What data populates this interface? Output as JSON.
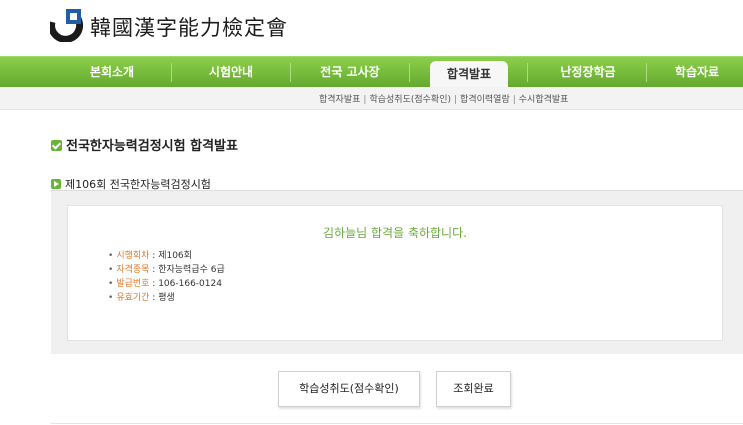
{
  "header": {
    "logo_text": "韓國漢字能力檢定會",
    "colors": {
      "brand_blue": "#1e5fa8",
      "brand_dark": "#1a1a1a",
      "nav_green": "#74bb3b",
      "accent_orange": "#e07a2c"
    }
  },
  "nav": {
    "items": [
      {
        "label": "본회소개"
      },
      {
        "label": "시험안내"
      },
      {
        "label": "전국 고사장"
      },
      {
        "label": "합격발표",
        "active": true
      },
      {
        "label": "난정장학금"
      },
      {
        "label": "학습자료"
      }
    ]
  },
  "subnav": {
    "links": [
      "합격자발표",
      "학습성취도(점수확인)",
      "합격이력열람",
      "수시합격발표"
    ],
    "separator": "|"
  },
  "main": {
    "page_title": "전국한자능력검정시험 합격발표",
    "section_title": "제106회 전국한자능력검정시험",
    "congrats": "김하늘님 합격을 축하합니다.",
    "info": [
      {
        "label": "시행회차",
        "value": "제106회"
      },
      {
        "label": "자격종목",
        "value": "한자능력급수 6급"
      },
      {
        "label": "발급번호",
        "value": "106-166-0124"
      },
      {
        "label": "유효기간",
        "value": "평생"
      }
    ]
  },
  "buttons": {
    "score_check": "학습성취도(점수확인)",
    "done": "조회완료"
  }
}
